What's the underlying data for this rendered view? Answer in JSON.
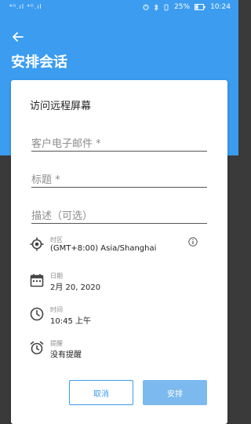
{
  "status_bar": {
    "signal": "⁴ᴳ.ıl ⁴ᴳ.ıl",
    "battery": "25%",
    "time": "10:24"
  },
  "header": {
    "title": "安排会话"
  },
  "dialog": {
    "title": "访问远程屏幕",
    "fields": {
      "email_placeholder": "客户电子邮件 *",
      "subject_placeholder": "标题 *",
      "description_placeholder": "描述（可选）"
    },
    "timezone": {
      "label": "时区",
      "value": "(GMT+8:00) Asia/Shanghai"
    },
    "date": {
      "label": "日期",
      "value": "2月 20, 2020"
    },
    "time": {
      "label": "时间",
      "value": "10:45 上午"
    },
    "reminder": {
      "label": "提醒",
      "value": "没有提醒"
    },
    "buttons": {
      "cancel": "取消",
      "schedule": "安排"
    }
  },
  "colors": {
    "accent": "#3b9cf0",
    "primary_disabled": "#7bb9ee",
    "dim_bg": "#3a3a3a"
  }
}
